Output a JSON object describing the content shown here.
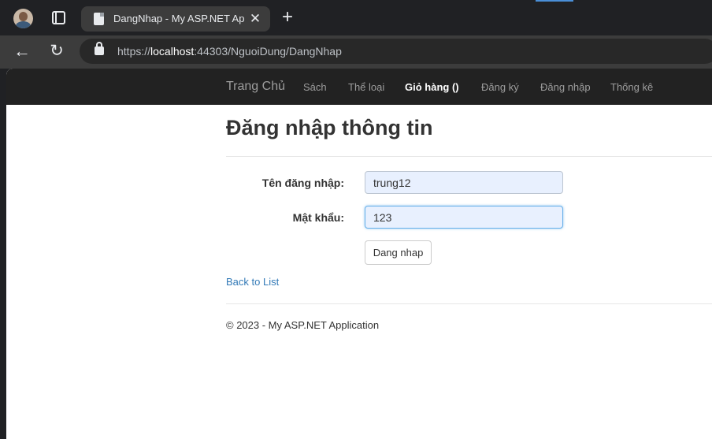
{
  "browser": {
    "tab_title": "DangNhap - My ASP.NET Application",
    "close_glyph": "✕",
    "new_tab_glyph": "+",
    "back_glyph": "←",
    "reload_glyph": "↻",
    "url_scheme": "https://",
    "url_host": "localhost",
    "url_rest": ":44303/NguoiDung/DangNhap"
  },
  "navbar": {
    "brand": "Trang Chủ",
    "links": [
      "Sách",
      "Thể loại",
      "Giỏ hàng ()",
      "Đăng ký",
      "Đăng nhập",
      "Thống kê"
    ],
    "active_link": "Giỏ hàng ()"
  },
  "page": {
    "title": "Đăng nhập thông tin",
    "username_label": "Tên đăng nhập:",
    "username_value": "trung12",
    "password_label": "Mật khẩu:",
    "password_value": "123",
    "submit_label": "Dang nhap",
    "back_link": "Back to List",
    "footer": "© 2023 - My ASP.NET Application"
  },
  "colors": {
    "navbar_bg": "#222222",
    "link_color": "#337ab7",
    "input_autofill": "#e8f0fe"
  }
}
